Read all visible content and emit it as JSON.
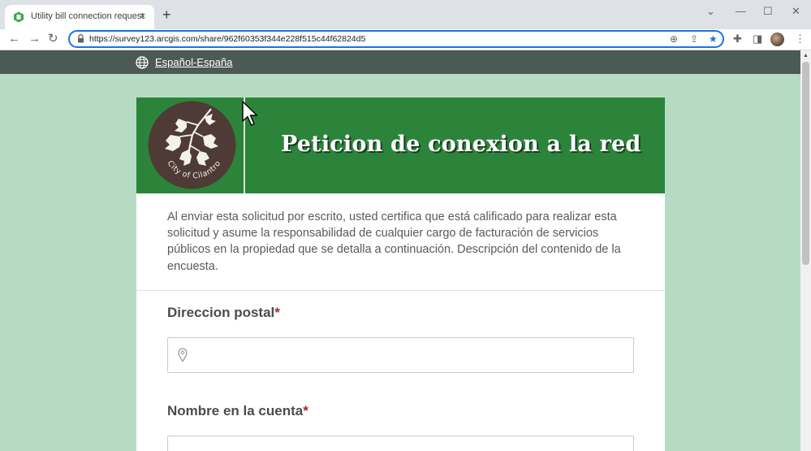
{
  "browser": {
    "tab_title": "Utility bill connection request",
    "tab_close": "×",
    "new_tab": "+",
    "url": "https://survey123.arcgis.com/share/962f60353f344e228f515c44f62824d5",
    "nav": {
      "back": "←",
      "forward": "→",
      "reload": "↻"
    },
    "window": {
      "dropdown": "⌄",
      "minimize": "—",
      "maximize": "☐",
      "close": "✕"
    },
    "omni_icons": {
      "zoom": "⊕",
      "share": "⇪",
      "bookmark": "★"
    },
    "toolbar_icons": {
      "extensions": "✚",
      "sidepanel": "◨",
      "menu": "⋮"
    }
  },
  "page": {
    "language": "Español-España",
    "header_title": "Peticion de conexion a la red",
    "logo_text": "City of Cilantro",
    "description": "Al enviar esta solicitud por escrito, usted certifica que está calificado para realizar esta solicitud y asume la responsabilidad de cualquier cargo de facturación de servicios públicos en la propiedad que se detalla a continuación. Descripción del contenido de la encuesta.",
    "fields": [
      {
        "label": "Direccion postal",
        "required_mark": "*",
        "value": ""
      },
      {
        "label": "Nombre en la cuenta",
        "required_mark": "*",
        "value": ""
      }
    ]
  },
  "colors": {
    "page_bg": "#b5dcc3",
    "lang_bar": "#4b5a54",
    "header_green": "#2b843a",
    "logo_brown": "#4e3b35",
    "required_red": "#a8282c",
    "accent_blue": "#1a73e8"
  },
  "icons": [
    "survey123-favicon",
    "lock-icon",
    "globe-icon",
    "location-pin-icon",
    "star-icon",
    "puzzle-icon",
    "kebab-menu-icon"
  ]
}
